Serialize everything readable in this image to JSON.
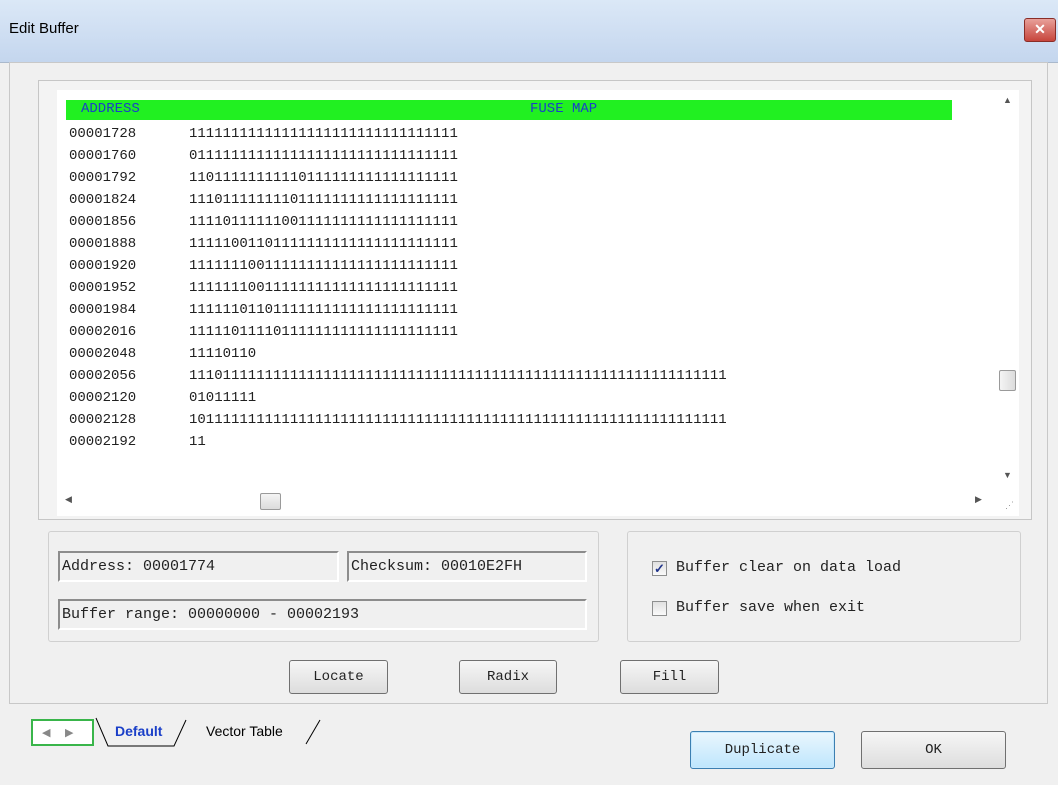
{
  "window": {
    "title": "Edit Buffer",
    "close_label": "✕"
  },
  "buffer": {
    "header_address": "ADDRESS",
    "header_fuse": "FUSE MAP",
    "rows": [
      {
        "address": "00001728",
        "data": "11111111111111111111111111111111"
      },
      {
        "address": "00001760",
        "data": "01111111111111111111111111111111"
      },
      {
        "address": "00001792",
        "data": "11011111111110111111111111111111"
      },
      {
        "address": "00001824",
        "data": "11101111111101111111111111111111"
      },
      {
        "address": "00001856",
        "data": "11110111111001111111111111111111"
      },
      {
        "address": "00001888",
        "data": "11111001101111111111111111111111"
      },
      {
        "address": "00001920",
        "data": "11111110011111111111111111111111"
      },
      {
        "address": "00001952",
        "data": "11111110011111111111111111111111"
      },
      {
        "address": "00001984",
        "data": "11111101101111111111111111111111"
      },
      {
        "address": "00002016",
        "data": "11111011110111111111111111111111"
      },
      {
        "address": "00002048",
        "data": "11110110"
      },
      {
        "address": "00002056",
        "data": "1110111111111111111111111111111111111111111111111111111111111111"
      },
      {
        "address": "00002120",
        "data": "01011111"
      },
      {
        "address": "00002128",
        "data": "1011111111111111111111111111111111111111111111111111111111111111"
      },
      {
        "address": "00002192",
        "data": "11"
      }
    ]
  },
  "info": {
    "address": "Address: 00001774",
    "checksum": "Checksum: 00010E2FH",
    "range": "Buffer range: 00000000 - 00002193"
  },
  "options": {
    "clear_on_load": {
      "label": "Buffer clear on data load",
      "checked": true
    },
    "save_on_exit": {
      "label": "Buffer save when exit",
      "checked": false
    }
  },
  "buttons": {
    "locate": "Locate",
    "radix": "Radix",
    "fill": "Fill",
    "duplicate": "Duplicate",
    "ok": "OK"
  },
  "tabs": {
    "default": "Default",
    "vector_table": "Vector Table"
  }
}
